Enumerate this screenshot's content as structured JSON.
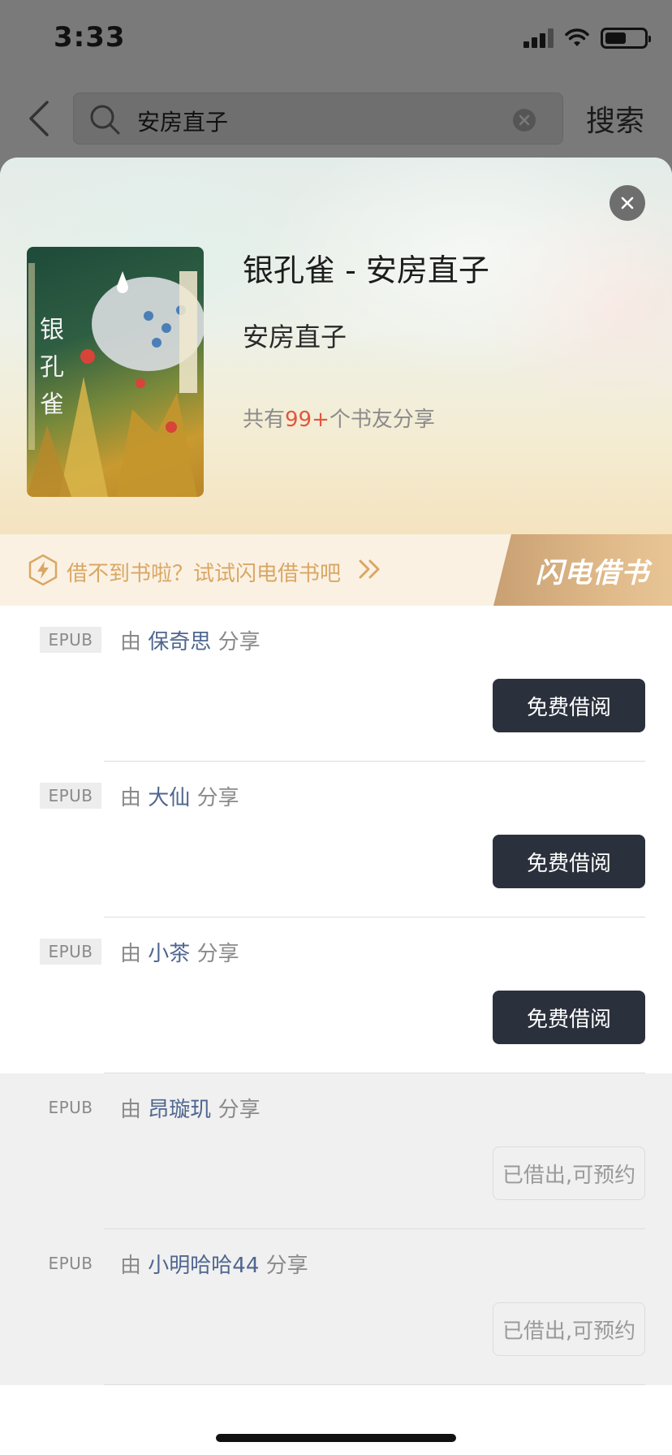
{
  "status_bar": {
    "time": "3:33"
  },
  "search": {
    "query": "安房直子",
    "button_label": "搜索"
  },
  "book": {
    "title": "银孔雀 - 安房直子",
    "author": "安房直子",
    "share_prefix": "共有",
    "share_count": "99+",
    "share_suffix": "个书友分享",
    "cover_text": "银孔雀"
  },
  "flash_banner": {
    "text": "借不到书啦？试试闪电借书吧",
    "brand": "闪电借书"
  },
  "shares": [
    {
      "format": "EPUB",
      "by": "由",
      "user": "保奇思",
      "suffix": "分享",
      "action": "免费借阅",
      "available": true
    },
    {
      "format": "EPUB",
      "by": "由",
      "user": "大仙",
      "suffix": "分享",
      "action": "免费借阅",
      "available": true
    },
    {
      "format": "EPUB",
      "by": "由",
      "user": "小茶",
      "suffix": "分享",
      "action": "免费借阅",
      "available": true
    },
    {
      "format": "EPUB",
      "by": "由",
      "user": "昂璇玑",
      "suffix": "分享",
      "action": "已借出,可预约",
      "available": false
    },
    {
      "format": "EPUB",
      "by": "由",
      "user": "小明哈哈44",
      "suffix": "分享",
      "action": "已借出,可预约",
      "available": false
    }
  ],
  "colors": {
    "accent_red": "#e4553d",
    "primary_button": "#2b313c",
    "flash_gold": "#d9a763",
    "user_link": "#4f6690"
  },
  "icons": [
    "back-icon",
    "search-icon",
    "clear-icon",
    "close-icon",
    "lightning-icon",
    "double-chevron-icon"
  ]
}
